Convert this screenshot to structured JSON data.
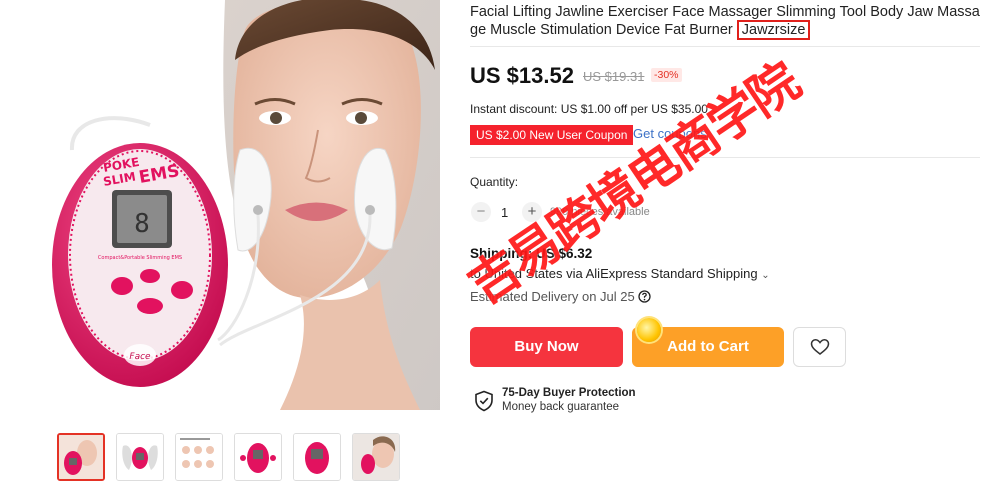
{
  "product": {
    "title_text": "Facial Lifting Jawline Exerciser Face Massager Slimming Tool Body Jaw Massage Muscle Stimulation Device Fat Burner",
    "brand_highlight": "Jawzrsize"
  },
  "pricing": {
    "price": "US $13.52",
    "original_price": "US $19.31",
    "discount": "-30%",
    "instant_discount": "Instant discount: US $1.00 off per US $35.00",
    "coupon_label": "US $2.00 New User Coupon",
    "get_coupons": "Get coupons"
  },
  "quantity": {
    "label": "Quantity:",
    "value": "1",
    "minus": "−",
    "plus": "+",
    "available": "999 pieces available"
  },
  "shipping": {
    "title": "Shipping: US $6.32",
    "to": "to United States via AliExpress Standard Shipping",
    "estimated": "Estimated Delivery on Jul 25"
  },
  "actions": {
    "buy_now": "Buy Now",
    "add_to_cart": "Add to Cart"
  },
  "protection": {
    "title": "75-Day Buyer Protection",
    "subtitle": "Money back guarantee"
  },
  "device": {
    "brand_line1": "POKE",
    "brand_line2": "SLIM",
    "brand_ems": "EMS",
    "display": "8",
    "caption": "Compact&Portable Slimming EMS",
    "logo": "Face"
  },
  "watermark": "吉易跨境电商学院",
  "colors": {
    "accent_red": "#f5343e",
    "cart_orange": "#fda027",
    "link_blue": "#3d72c7",
    "device_pink": "#e2125f"
  }
}
